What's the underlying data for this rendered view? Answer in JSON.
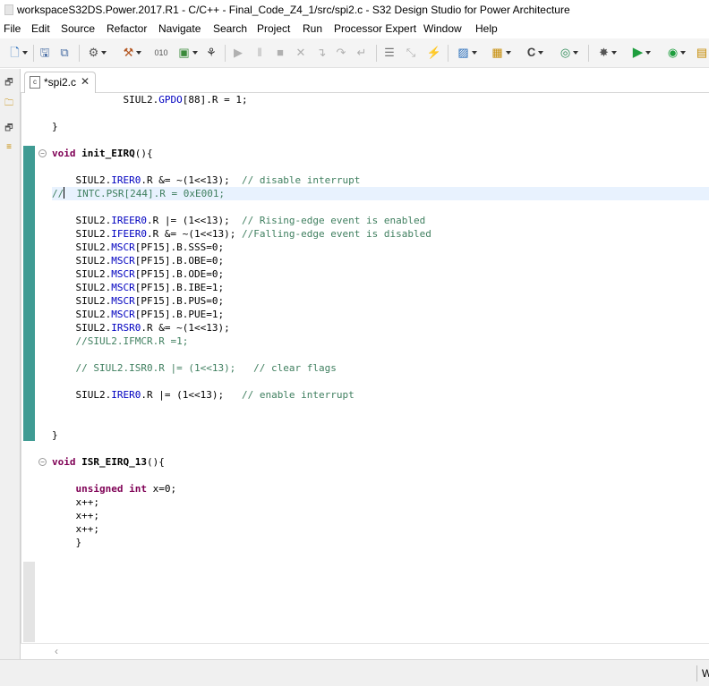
{
  "window": {
    "title": "workspaceS32DS.Power.2017.R1 - C/C++ - Final_Code_Z4_1/src/spi2.c - S32 Design Studio for Power Architecture"
  },
  "menu": [
    "File",
    "Edit",
    "Source",
    "Refactor",
    "Navigate",
    "Search",
    "Project",
    "Run",
    "Processor Expert",
    "Window",
    "Help"
  ],
  "toolbar": {
    "icons": [
      "new-icon",
      "save-icon",
      "save-all-icon",
      "build-config-icon",
      "build-hammer-icon",
      "binary-icon",
      "new-connection-icon",
      "tool-icon",
      "resume-icon",
      "suspend-icon",
      "terminate-icon",
      "disconnect-icon",
      "step-into-icon",
      "step-over-icon",
      "step-return-icon",
      "toggle-icon",
      "skip-breakpoints-icon",
      "lightning-icon",
      "new-project-icon",
      "new-package-icon",
      "new-class-icon",
      "open-type-icon",
      "debug-icon",
      "run-icon",
      "external-tools-icon"
    ]
  },
  "editor": {
    "tab": {
      "label": "*spi2.c",
      "icon": "c-file-icon"
    },
    "lines": [
      "            SIUL2.GPDO[88].R = 1;",
      "",
      "}",
      "",
      "void init_EIRQ(){",
      "",
      "    SIUL2.IRER0.R &= ~(1<<13);  // disable interrupt",
      "//  INTC.PSR[244].R = 0xE001;",
      "",
      "    SIUL2.IREER0.R |= (1<<13);  // Rising-edge event is enabled",
      "    SIUL2.IFEER0.R &= ~(1<<13); //Falling-edge event is disabled",
      "    SIUL2.MSCR[PF15].B.SSS=0;",
      "    SIUL2.MSCR[PF15].B.OBE=0;",
      "    SIUL2.MSCR[PF15].B.ODE=0;",
      "    SIUL2.MSCR[PF15].B.IBE=1;",
      "    SIUL2.MSCR[PF15].B.PUS=0;",
      "    SIUL2.MSCR[PF15].B.PUE=1;",
      "    SIUL2.IRSR0.R &= ~(1<<13);",
      "    //SIUL2.IFMCR.R =1;",
      "",
      "    // SIUL2.ISR0.R |= (1<<13);   // clear flags",
      "",
      "    SIUL2.IRER0.R |= (1<<13);   // enable interrupt",
      "",
      "",
      "}",
      "",
      "void ISR_EIRQ_13(){",
      "",
      "    unsigned int x=0;",
      "    x++;",
      "    x++;",
      "    x++;",
      "    }"
    ]
  },
  "statusbar": {
    "fast_view_label": "W"
  }
}
